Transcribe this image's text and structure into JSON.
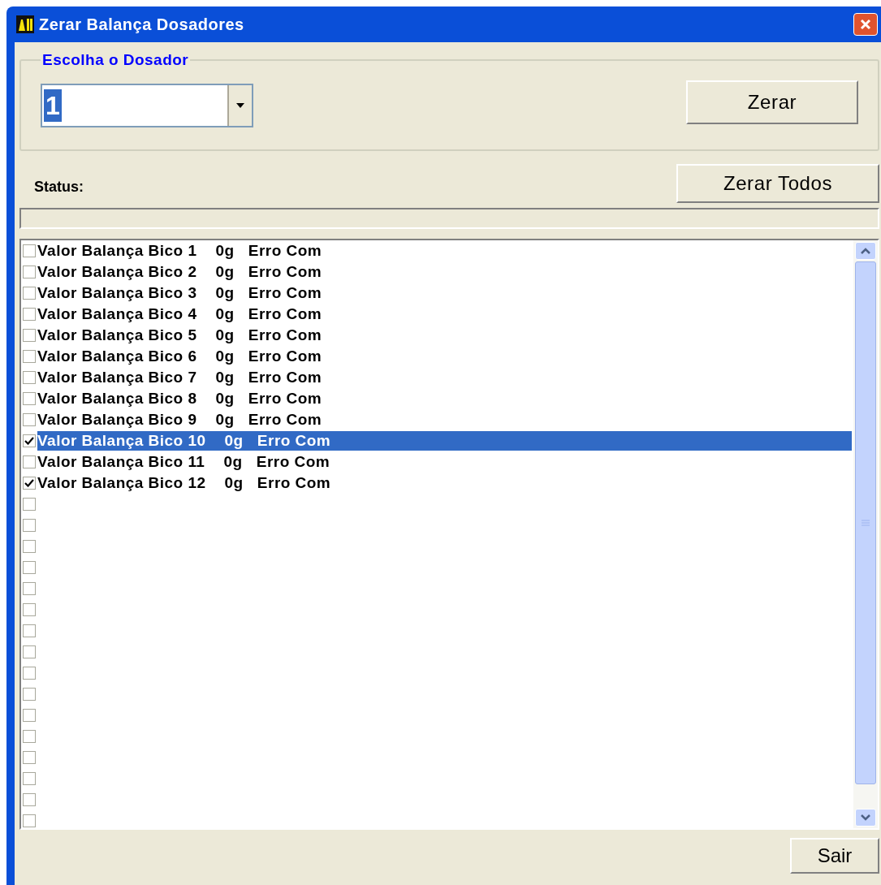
{
  "window": {
    "title": "Zerar Balança Dosadores"
  },
  "group": {
    "title": "Escolha o Dosador",
    "combo_value": "1",
    "zero_button": "Zerar"
  },
  "zero_all_button": "Zerar Todos",
  "status": {
    "label": "Status:"
  },
  "items": [
    {
      "label": "Valor Balança Bico 1    0g   Erro Com",
      "checked": false,
      "selected": false
    },
    {
      "label": "Valor Balança Bico 2    0g   Erro Com",
      "checked": false,
      "selected": false
    },
    {
      "label": "Valor Balança Bico 3    0g   Erro Com",
      "checked": false,
      "selected": false
    },
    {
      "label": "Valor Balança Bico 4    0g   Erro Com",
      "checked": false,
      "selected": false
    },
    {
      "label": "Valor Balança Bico 5    0g   Erro Com",
      "checked": false,
      "selected": false
    },
    {
      "label": "Valor Balança Bico 6    0g   Erro Com",
      "checked": false,
      "selected": false
    },
    {
      "label": "Valor Balança Bico 7    0g   Erro Com",
      "checked": false,
      "selected": false
    },
    {
      "label": "Valor Balança Bico 8    0g   Erro Com",
      "checked": false,
      "selected": false
    },
    {
      "label": "Valor Balança Bico 9    0g   Erro Com",
      "checked": false,
      "selected": false
    },
    {
      "label": "Valor Balança Bico 10    0g   Erro Com",
      "checked": true,
      "selected": true
    },
    {
      "label": "Valor Balança Bico 11    0g   Erro Com",
      "checked": false,
      "selected": false
    },
    {
      "label": "Valor Balança Bico 12    0g   Erro Com",
      "checked": true,
      "selected": false
    },
    {
      "checked": false,
      "selected": false
    },
    {
      "checked": false,
      "selected": false
    },
    {
      "checked": false,
      "selected": false
    },
    {
      "checked": false,
      "selected": false
    },
    {
      "checked": false,
      "selected": false
    },
    {
      "checked": false,
      "selected": false
    },
    {
      "checked": false,
      "selected": false
    },
    {
      "checked": false,
      "selected": false
    },
    {
      "checked": false,
      "selected": false
    },
    {
      "checked": false,
      "selected": false
    },
    {
      "checked": false,
      "selected": false
    },
    {
      "checked": false,
      "selected": false
    },
    {
      "checked": false,
      "selected": false
    },
    {
      "checked": false,
      "selected": false
    },
    {
      "checked": false,
      "selected": false
    },
    {
      "checked": false,
      "selected": false
    }
  ],
  "exit_button": "Sair"
}
